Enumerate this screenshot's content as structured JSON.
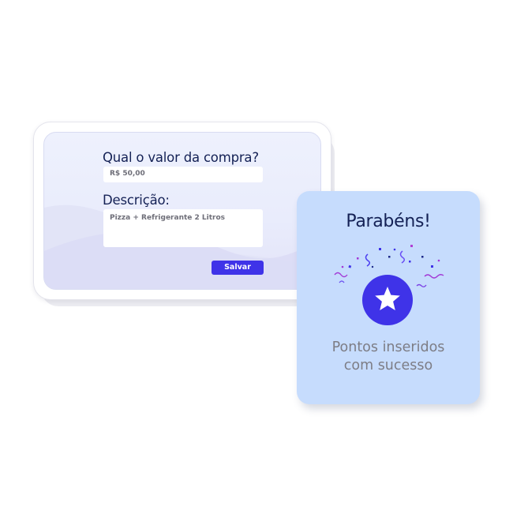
{
  "form": {
    "amount_question": "Qual o valor da compra?",
    "amount_value": "R$ 50,00",
    "description_label": "Descrição:",
    "description_value": "Pizza + Refrigerante 2 Litros",
    "save_label": "Salvar"
  },
  "success": {
    "title": "Parabéns!",
    "message_line1": "Pontos inseridos",
    "message_line2": "com sucesso",
    "icon": "star-icon"
  },
  "colors": {
    "accent": "#3f33e8",
    "heading": "#142155",
    "success_card_bg": "#c6dcfd",
    "muted_text": "#7d7d85"
  }
}
